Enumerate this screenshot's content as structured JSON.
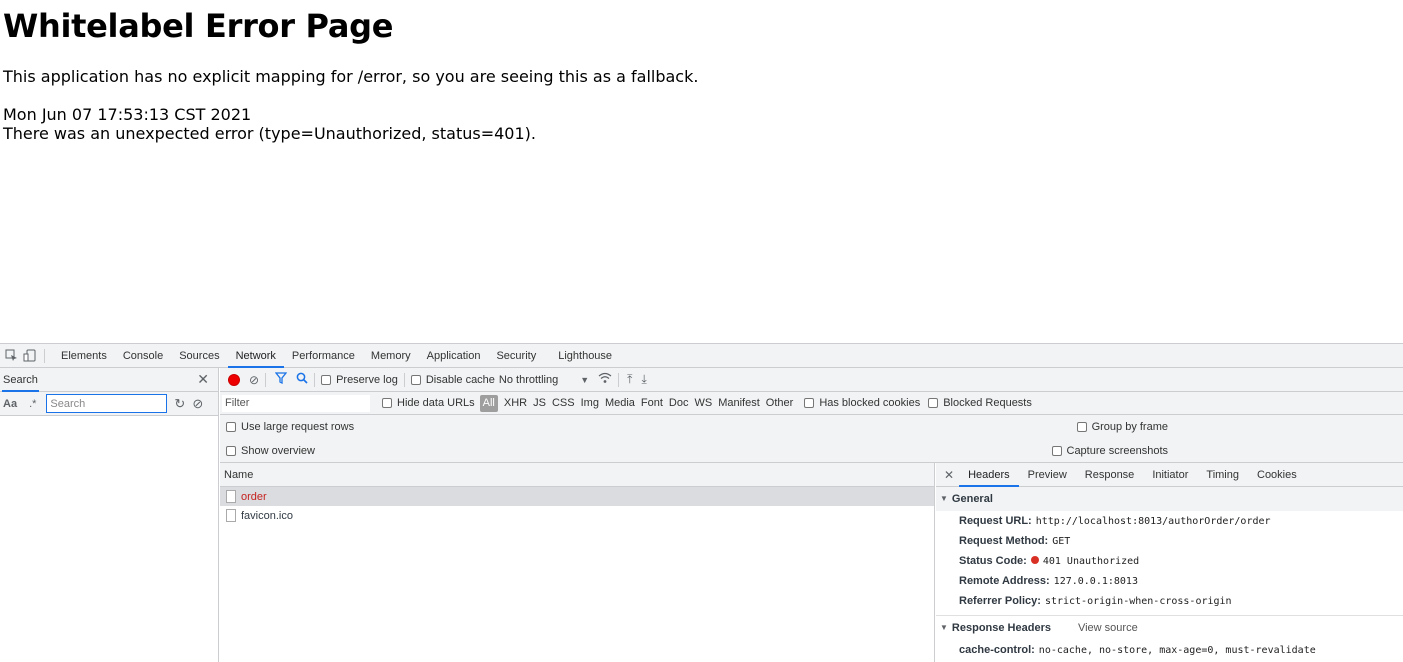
{
  "page": {
    "title": "Whitelabel Error Page",
    "message": "This application has no explicit mapping for /error, so you are seeing this as a fallback.",
    "timestamp": "Mon Jun 07 17:53:13 CST 2021",
    "error": "There was an unexpected error (type=Unauthorized, status=401)."
  },
  "devtools": {
    "tabs": [
      "Elements",
      "Console",
      "Sources",
      "Network",
      "Performance",
      "Memory",
      "Application",
      "Security",
      "Lighthouse"
    ],
    "active_tab": "Network",
    "search": {
      "label": "Search",
      "case_label": "Aa",
      "regex_label": ".*",
      "placeholder": "Search"
    },
    "toolbar": {
      "preserve_log": "Preserve log",
      "disable_cache": "Disable cache",
      "throttling": "No throttling"
    },
    "filter": {
      "placeholder": "Filter",
      "hide_data_urls": "Hide data URLs",
      "types": [
        "All",
        "XHR",
        "JS",
        "CSS",
        "Img",
        "Media",
        "Font",
        "Doc",
        "WS",
        "Manifest",
        "Other"
      ],
      "has_blocked_cookies": "Has blocked cookies",
      "blocked_requests": "Blocked Requests"
    },
    "options": {
      "large_rows": "Use large request rows",
      "show_overview": "Show overview",
      "group_by_frame": "Group by frame",
      "capture_screenshots": "Capture screenshots"
    },
    "requests": {
      "column": "Name",
      "items": [
        "order",
        "favicon.ico"
      ]
    },
    "details": {
      "tabs": [
        "Headers",
        "Preview",
        "Response",
        "Initiator",
        "Timing",
        "Cookies"
      ],
      "general_title": "General",
      "general": [
        {
          "key": "Request URL:",
          "value": "http://localhost:8013/authorOrder/order"
        },
        {
          "key": "Request Method:",
          "value": "GET"
        },
        {
          "key": "Status Code:",
          "value": "401 Unauthorized"
        },
        {
          "key": "Remote Address:",
          "value": "127.0.0.1:8013"
        },
        {
          "key": "Referrer Policy:",
          "value": "strict-origin-when-cross-origin"
        }
      ],
      "response_title": "Response Headers",
      "view_source": "View source",
      "response": [
        {
          "key": "cache-control:",
          "value": "no-cache, no-store, max-age=0, must-revalidate"
        }
      ]
    }
  }
}
